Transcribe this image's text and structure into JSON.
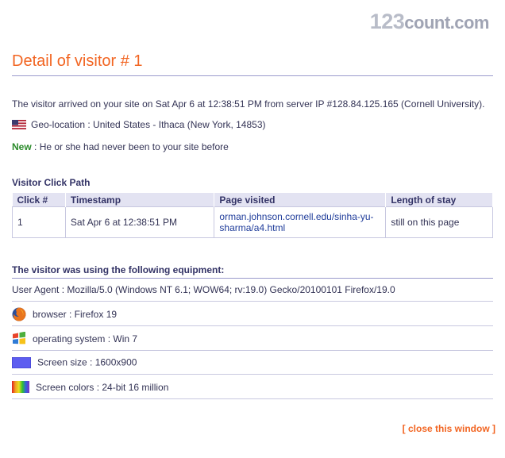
{
  "logo": {
    "num": "123",
    "txt": "count.com"
  },
  "title": "Detail of visitor # 1",
  "arrival": "The visitor arrived on your site on Sat Apr 6 at 12:38:51 PM from server IP #128.84.125.165 (Cornell University).",
  "geo": "Geo-location : United States - Ithaca (New York, 14853)",
  "new_label": "New",
  "new_text": " : He or she had never been to your site before",
  "click_path": {
    "heading": "Visitor Click Path",
    "columns": [
      "Click #",
      "Timestamp",
      "Page visited",
      "Length of stay"
    ],
    "rows": [
      {
        "click": "1",
        "timestamp": "Sat Apr 6 at 12:38:51 PM",
        "page": "orman.johnson.cornell.edu/sinha-yu-sharma/a4.html",
        "stay": "still on this page"
      }
    ]
  },
  "equipment": {
    "heading": "The visitor was using the following equipment:",
    "user_agent": "User Agent : Mozilla/5.0 (Windows NT 6.1; WOW64; rv:19.0) Gecko/20100101 Firefox/19.0",
    "browser": "browser : Firefox 19",
    "os": "operating system : Win 7",
    "screen_size": "Screen size : 1600x900",
    "screen_colors": "Screen colors : 24-bit 16 million"
  },
  "close_label": "[ close this window ]",
  "colors": {
    "accent": "#f26522",
    "header_bg": "#e3e3f2",
    "link": "#1f3c9a",
    "new": "#2a8a2a"
  }
}
